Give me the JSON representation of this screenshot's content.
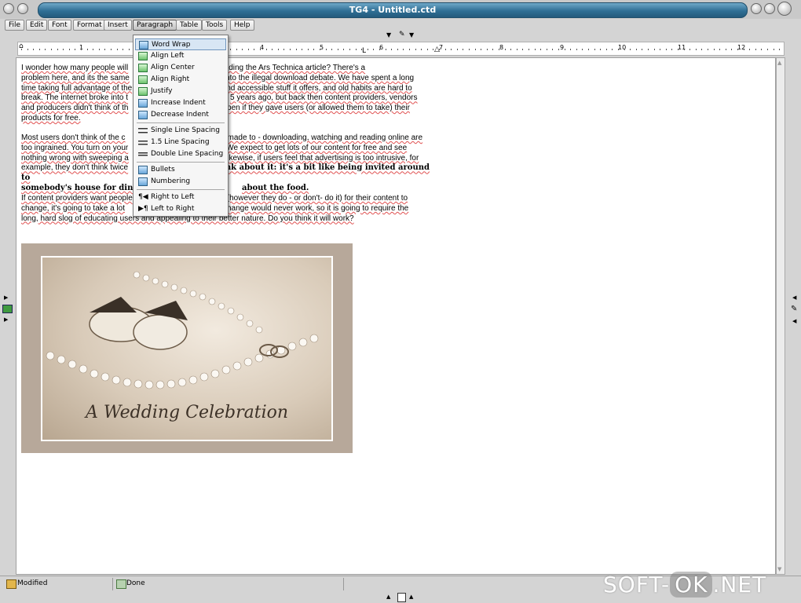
{
  "window": {
    "title": "TG4 - Untitled.ctd"
  },
  "menubar": [
    "File",
    "Edit",
    "Font",
    "Format",
    "Insert",
    "Paragraph",
    "Table",
    "Tools",
    "Help"
  ],
  "ruler_numbers": [
    "1",
    "2",
    "3",
    "4",
    "5",
    "6",
    "7",
    "8",
    "9",
    "10",
    "11",
    "12"
  ],
  "paragraph_menu": {
    "items": [
      {
        "label": "Word Wrap",
        "icon": "word-wrap-icon",
        "selected": true
      },
      {
        "label": "Align Left",
        "icon": "align-left-icon"
      },
      {
        "label": "Align Center",
        "icon": "align-center-icon"
      },
      {
        "label": "Align Right",
        "icon": "align-right-icon"
      },
      {
        "label": "Justify",
        "icon": "justify-icon"
      },
      {
        "label": "Increase Indent",
        "icon": "increase-indent-icon"
      },
      {
        "label": "Decrease Indent",
        "icon": "decrease-indent-icon"
      },
      {
        "label": "Single Line Spacing",
        "icon": "single-spacing-icon"
      },
      {
        "label": "1.5 Line Spacing",
        "icon": "one-half-spacing-icon"
      },
      {
        "label": "Double Line Spacing",
        "icon": "double-spacing-icon"
      },
      {
        "label": "Bullets",
        "icon": "bullets-icon"
      },
      {
        "label": "Numbering",
        "icon": "numbering-icon"
      },
      {
        "label": "Right to Left",
        "icon": "rtl-icon"
      },
      {
        "label": "Left to Right",
        "icon": "ltr-icon"
      }
    ]
  },
  "document": {
    "p1": [
      "I wonder how many people will",
      "s after reading the Ars Technica article? There's a",
      "problem here, and its the same",
      "into the illegal download debate. We have spent a long",
      "time taking full advantage of the",
      "nd accessible stuff it offers, and old habits are hard to",
      "break. The internet broke into t",
      "5 years ago, but back then content providers, vendors",
      "and producers didn't think of th",
      "ppen if they gave users (or allowed them to take) their",
      "products for free."
    ],
    "p2": [
      "Most users don't think of the c",
      "made to - downloading, watching and reading online are",
      "too ingrained. You turn on your",
      "We expect to get lots of our content for free and see",
      "nothing wrong with sweeping a",
      "Likewise, if users feel that advertising is too intrusive, for",
      "example, they don't think twice",
      "ink about it: it's a bit like being invited around to",
      "somebody's house for dinne",
      "about the food."
    ],
    "p3": [
      "If content providers want people",
      "(however they do - or don't- do it) for their content to",
      "change, it's going to take a lot",
      "change would never work, so it is going to require the",
      "long, hard slog of educating users and appealing to their better nature. Do you think it will work?"
    ],
    "image_caption": "A Wedding Celebration"
  },
  "statusbar": {
    "left": "Modified",
    "middle": "Done"
  },
  "watermark": {
    "left": "SOFT-",
    "pill": "OK",
    "right": ".NET"
  }
}
